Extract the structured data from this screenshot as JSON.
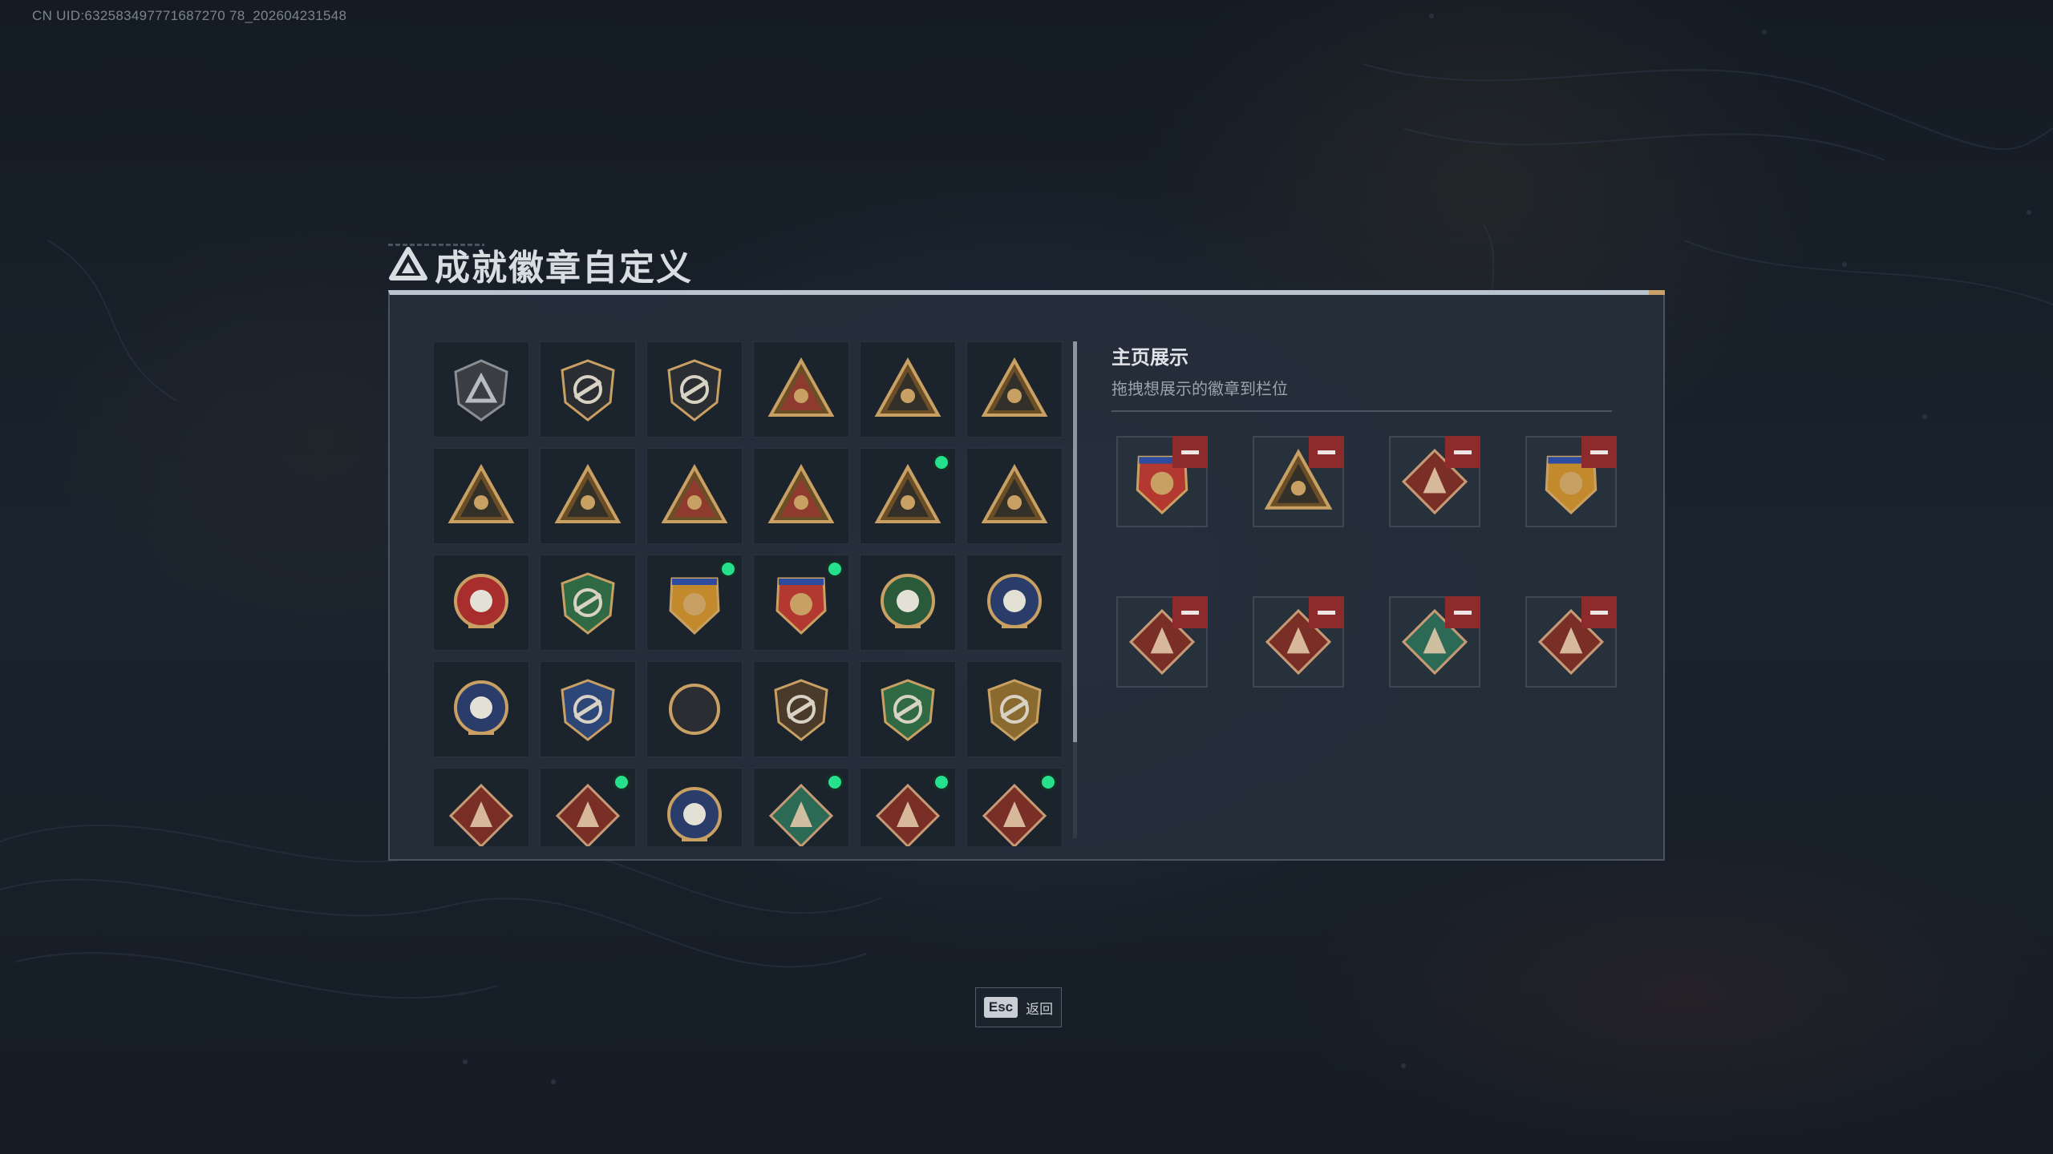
{
  "uid_text": "CN UID:632583497771687270 78_202604231548",
  "window": {
    "title": "成就徽章自定义",
    "title_logo_icon": "triangle-logo-icon"
  },
  "colors": {
    "accent_gold": "#c8a26a",
    "new_dot": "#25e08d",
    "remove_red": "#8c2a2c"
  },
  "badge_grid": {
    "rows": [
      [
        {
          "icon": "triangle-shield-badge",
          "new": false
        },
        {
          "icon": "helicopter-shield-badge",
          "new": false
        },
        {
          "icon": "blade-shield-badge",
          "new": false
        },
        {
          "icon": "eye-triangle-badge",
          "new": false
        },
        {
          "icon": "level-54-triangle-badge",
          "new": false
        },
        {
          "icon": "level-55-triangle-badge",
          "new": false
        }
      ],
      [
        {
          "icon": "level-57-triangle-badge",
          "new": false
        },
        {
          "icon": "level-58-triangle-badge",
          "new": false
        },
        {
          "icon": "boat-triangle-badge",
          "new": false
        },
        {
          "icon": "number-1-triangle-badge",
          "new": false
        },
        {
          "icon": "star-triangle-badge",
          "new": true
        },
        {
          "icon": "soldier-triangle-badge",
          "new": false
        }
      ],
      [
        {
          "icon": "gold-star-emblem-badge",
          "new": false
        },
        {
          "icon": "green-shield-badge",
          "new": false
        },
        {
          "icon": "gold-crest-badge",
          "new": true
        },
        {
          "icon": "red-crest-badge",
          "new": true
        },
        {
          "icon": "green-skull-target-badge",
          "new": false
        },
        {
          "icon": "blue-skull-badge",
          "new": false
        }
      ],
      [
        {
          "icon": "blue-spike-emblem-badge",
          "new": false
        },
        {
          "icon": "blue-rifle-shield-badge",
          "new": false
        },
        {
          "icon": "blue-rifle-wings-badge",
          "new": false
        },
        {
          "icon": "brown-rifle-shield-badge",
          "new": false
        },
        {
          "icon": "green-rifle-shield-badge",
          "new": false
        },
        {
          "icon": "gold-rifle-shield-badge",
          "new": false
        }
      ],
      [
        {
          "icon": "wolf-diamond-badge",
          "new": false
        },
        {
          "icon": "wolf-diamond-badge",
          "new": true
        },
        {
          "icon": "eagle-circle-badge",
          "new": false
        },
        {
          "icon": "green-gun-diamond-badge",
          "new": true
        },
        {
          "icon": "dragon-diamond-badge",
          "new": true
        },
        {
          "icon": "dragon-diamond-badge",
          "new": true
        }
      ]
    ]
  },
  "showcase": {
    "title": "主页展示",
    "subtitle": "拖拽想展示的徽章到栏位",
    "slots": [
      {
        "icon": "red-crest-badge"
      },
      {
        "icon": "star-triangle-badge"
      },
      {
        "icon": "dragon-diamond-badge"
      },
      {
        "icon": "gold-crest-badge"
      },
      {
        "icon": "rifle-diamond-badge"
      },
      {
        "icon": "dragon-diamond-badge"
      },
      {
        "icon": "green-gun-diamond-badge"
      },
      {
        "icon": "wolf-diamond-badge"
      }
    ]
  },
  "footer": {
    "esc_key": "Esc",
    "esc_label": "返回"
  }
}
